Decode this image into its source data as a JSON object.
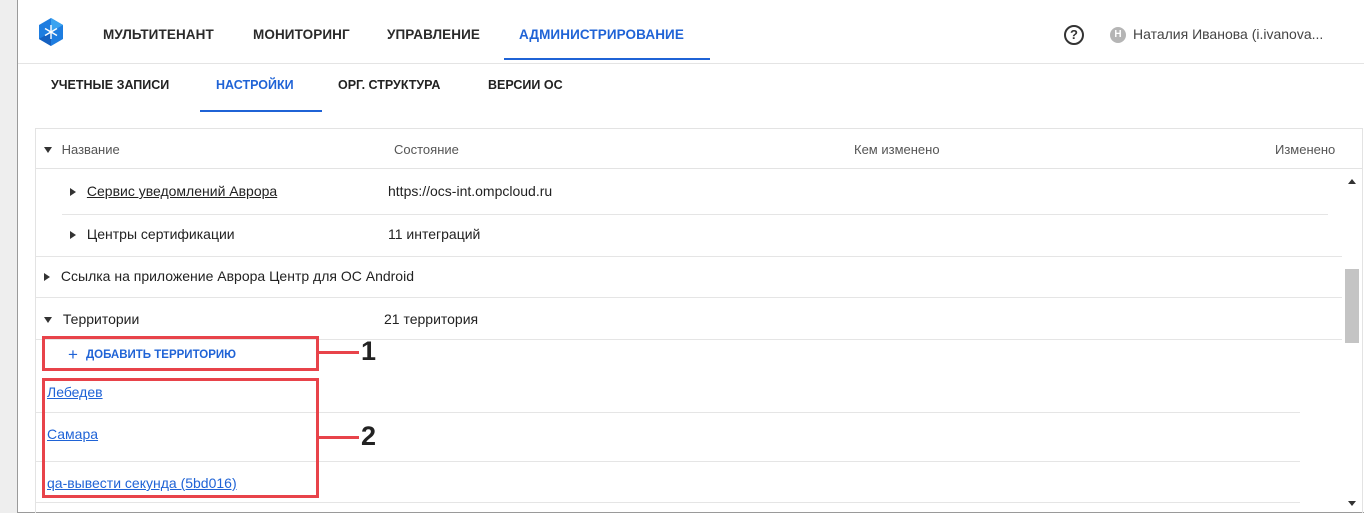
{
  "topnav": {
    "items": [
      {
        "label": "МУЛЬТИТЕНАНТ",
        "active": false
      },
      {
        "label": "МОНИТОРИНГ",
        "active": false
      },
      {
        "label": "УПРАВЛЕНИЕ",
        "active": false
      },
      {
        "label": "АДМИНИСТРИРОВАНИЕ",
        "active": true
      }
    ],
    "help_glyph": "?",
    "avatar_letter": "Н",
    "user_name": "Наталия Иванова (i.ivanova..."
  },
  "subnav": {
    "tabs": [
      {
        "label": "УЧЕТНЫЕ ЗАПИСИ",
        "active": false
      },
      {
        "label": "НАСТРОЙКИ",
        "active": true
      },
      {
        "label": "ОРГ. СТРУКТУРА",
        "active": false
      },
      {
        "label": "ВЕРСИИ ОС",
        "active": false
      }
    ]
  },
  "table": {
    "headers": {
      "name": "Название",
      "state": "Состояние",
      "changed_by": "Кем изменено",
      "changed": "Изменено"
    },
    "rows": {
      "aurora_notify": {
        "label": "Сервис уведомлений Аврора",
        "value": "https://ocs-int.ompcloud.ru"
      },
      "cert_centers": {
        "label": "Центры сертификации",
        "value": "11 интеграций"
      },
      "android_link": {
        "label": "Ссылка на приложение Аврора Центр для ОС Android"
      },
      "territories": {
        "label": "Территории",
        "value": "21 территория"
      }
    },
    "add_territory_label": "ДОБАВИТЬ ТЕРРИТОРИЮ",
    "territory_items": [
      "Лебедев",
      "Самара",
      "qa-вывести секунда (5bd016)"
    ]
  },
  "callouts": {
    "one": "1",
    "two": "2"
  },
  "colors": {
    "accent": "#1f63d6",
    "callout": "#e8434a"
  }
}
